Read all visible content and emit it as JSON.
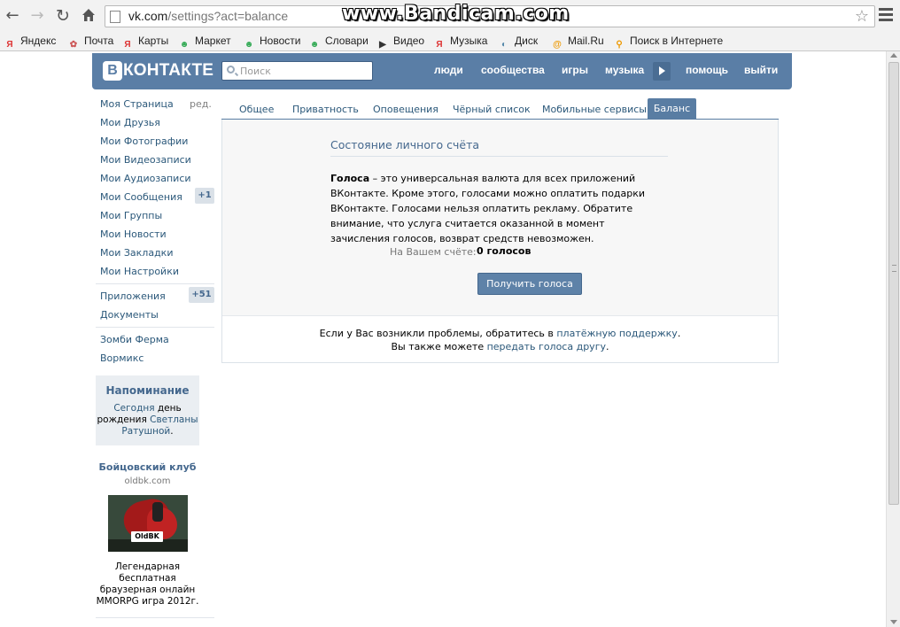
{
  "browser": {
    "url_host": "vk.com",
    "url_path": "/settings?act=balance",
    "watermark": "www.Bandicam.com",
    "bookmarks": [
      {
        "label": "Яндекс",
        "icon": "yandex-icon",
        "color": "#d33"
      },
      {
        "label": "Почта",
        "icon": "mail-icon",
        "color": "#c55"
      },
      {
        "label": "Карты",
        "icon": "yandex-icon",
        "color": "#d33"
      },
      {
        "label": "Маркет",
        "icon": "market-icon",
        "color": "#3a5"
      },
      {
        "label": "Новости",
        "icon": "news-icon",
        "color": "#3a5"
      },
      {
        "label": "Словари",
        "icon": "dictionary-icon",
        "color": "#3a5"
      },
      {
        "label": "Видео",
        "icon": "video-icon",
        "color": "#333"
      },
      {
        "label": "Музыка",
        "icon": "yandex-icon",
        "color": "#d33"
      },
      {
        "label": "Диск",
        "icon": "disk-icon",
        "color": "#58a"
      },
      {
        "label": "Mail.Ru",
        "icon": "mailru-icon",
        "color": "#e90"
      },
      {
        "label": "Поиск в Интернете",
        "icon": "search-magnifier-icon",
        "color": "#e90"
      }
    ]
  },
  "header": {
    "logo_letter": "В",
    "logo_text": "КОНТАКТЕ",
    "search_placeholder": "Поиск",
    "nav": [
      "люди",
      "сообщества",
      "игры",
      "музыка",
      "помощь",
      "выйти"
    ],
    "accent": "#5a7ea6"
  },
  "sidebar": {
    "edit_label": "ред.",
    "items": [
      {
        "label": "Моя Страница"
      },
      {
        "label": "Мои Друзья"
      },
      {
        "label": "Мои Фотографии"
      },
      {
        "label": "Мои Видеозаписи"
      },
      {
        "label": "Мои Аудиозаписи"
      },
      {
        "label": "Мои Сообщения",
        "counter": "+1"
      },
      {
        "label": "Мои Группы"
      },
      {
        "label": "Мои Новости"
      },
      {
        "label": "Мои Закладки"
      },
      {
        "label": "Мои Настройки"
      }
    ],
    "items2": [
      {
        "label": "Приложения",
        "counter": "+51"
      },
      {
        "label": "Документы"
      }
    ],
    "apps": [
      "Зомби Ферма",
      "Вормикс"
    ],
    "reminder": {
      "title": "Напоминание",
      "today": "Сегодня",
      "birthday_text": "день рождения",
      "name": "Светланы Ратушной",
      "period": "."
    },
    "ad": {
      "title": "Бойцовский клуб",
      "domain": "oldbk.com",
      "image_logo": "OldBK",
      "text": "Легендарная бесплатная браузерная онлайн MMORPG игра 2012г."
    }
  },
  "main": {
    "tabs": [
      "Общее",
      "Приватность",
      "Оповещения",
      "Чёрный список",
      "Мобильные сервисы",
      "Баланс"
    ],
    "active_tab": "Баланс",
    "section_title": "Состояние личного счёта",
    "desc_bold": "Голоса",
    "desc_rest": " – это универсальная валюта для всех приложений ВКонтакте. Кроме этого, голосами можно оплатить подарки ВКонтакте. Голосами нельзя оплатить рекламу. Обратите внимание, что услуга считается оказанной в момент зачисления голосов, возврат средств невозможен.",
    "balance_label": "На Вашем счёте:",
    "balance_value": "0 голосов",
    "button_label": "Получить голоса",
    "help_prefix": "Если у Вас возникли проблемы, обратитесь в ",
    "help_link": "платёжную поддержку",
    "help_suffix": ".",
    "transfer_prefix": "Вы также можете ",
    "transfer_link": "передать голоса другу",
    "transfer_suffix": "."
  }
}
